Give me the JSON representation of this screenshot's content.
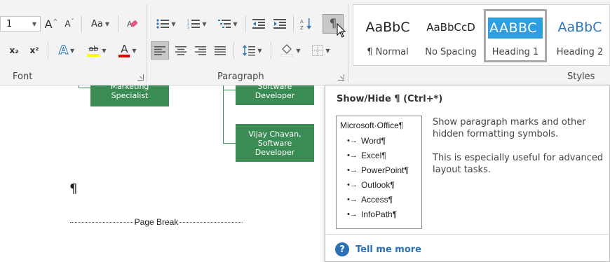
{
  "ribbon": {
    "font_group": {
      "label": "Font",
      "font_size_value": "1",
      "grow_font": "A",
      "shrink_font": "A",
      "change_case": "Aa",
      "subscript": "x₂",
      "superscript": "x²",
      "text_effects": "A",
      "highlight": "ab",
      "font_color": "A"
    },
    "paragraph_group": {
      "label": "Paragraph",
      "show_hide": "¶"
    },
    "styles_group": {
      "label": "Styles",
      "items": [
        {
          "preview": "AaBbC",
          "name": "¶ Normal"
        },
        {
          "preview": "AaBbCcD",
          "name": "No Spacing"
        },
        {
          "preview": "AABBC",
          "name": "Heading 1"
        },
        {
          "preview": "AaBbC",
          "name": "Heading 2"
        }
      ]
    }
  },
  "document": {
    "org_chart": {
      "box1": "Marketing Specialist",
      "box2": "Software Developer",
      "box3_name": "Vijay Chavan,",
      "box3_role": "Software Developer"
    },
    "pilcrow": "¶",
    "page_break": "Page Break"
  },
  "tooltip": {
    "title": "Show/Hide ¶ (Ctrl+*)",
    "preview_heading": "Microsoft·Office¶",
    "preview_items": [
      "Word¶",
      "Excel¶",
      "PowerPoint¶",
      "Outlook¶",
      "Access¶",
      "InfoPath¶"
    ],
    "bullet": "•→",
    "desc1": "Show paragraph marks and other hidden formatting symbols.",
    "desc2": "This is especially useful for advanced layout tasks.",
    "help_icon": "?",
    "tell_me_more": "Tell me more"
  },
  "colors": {
    "ribbon_bg": "#f3f3f3",
    "heading1_fill": "#2e9ee0",
    "style_blue": "#2e75b6",
    "org_green": "#3b8c54",
    "highlight_yellow": "#ffff00",
    "font_color_red": "#e00000",
    "link_blue": "#2b6fb5"
  }
}
